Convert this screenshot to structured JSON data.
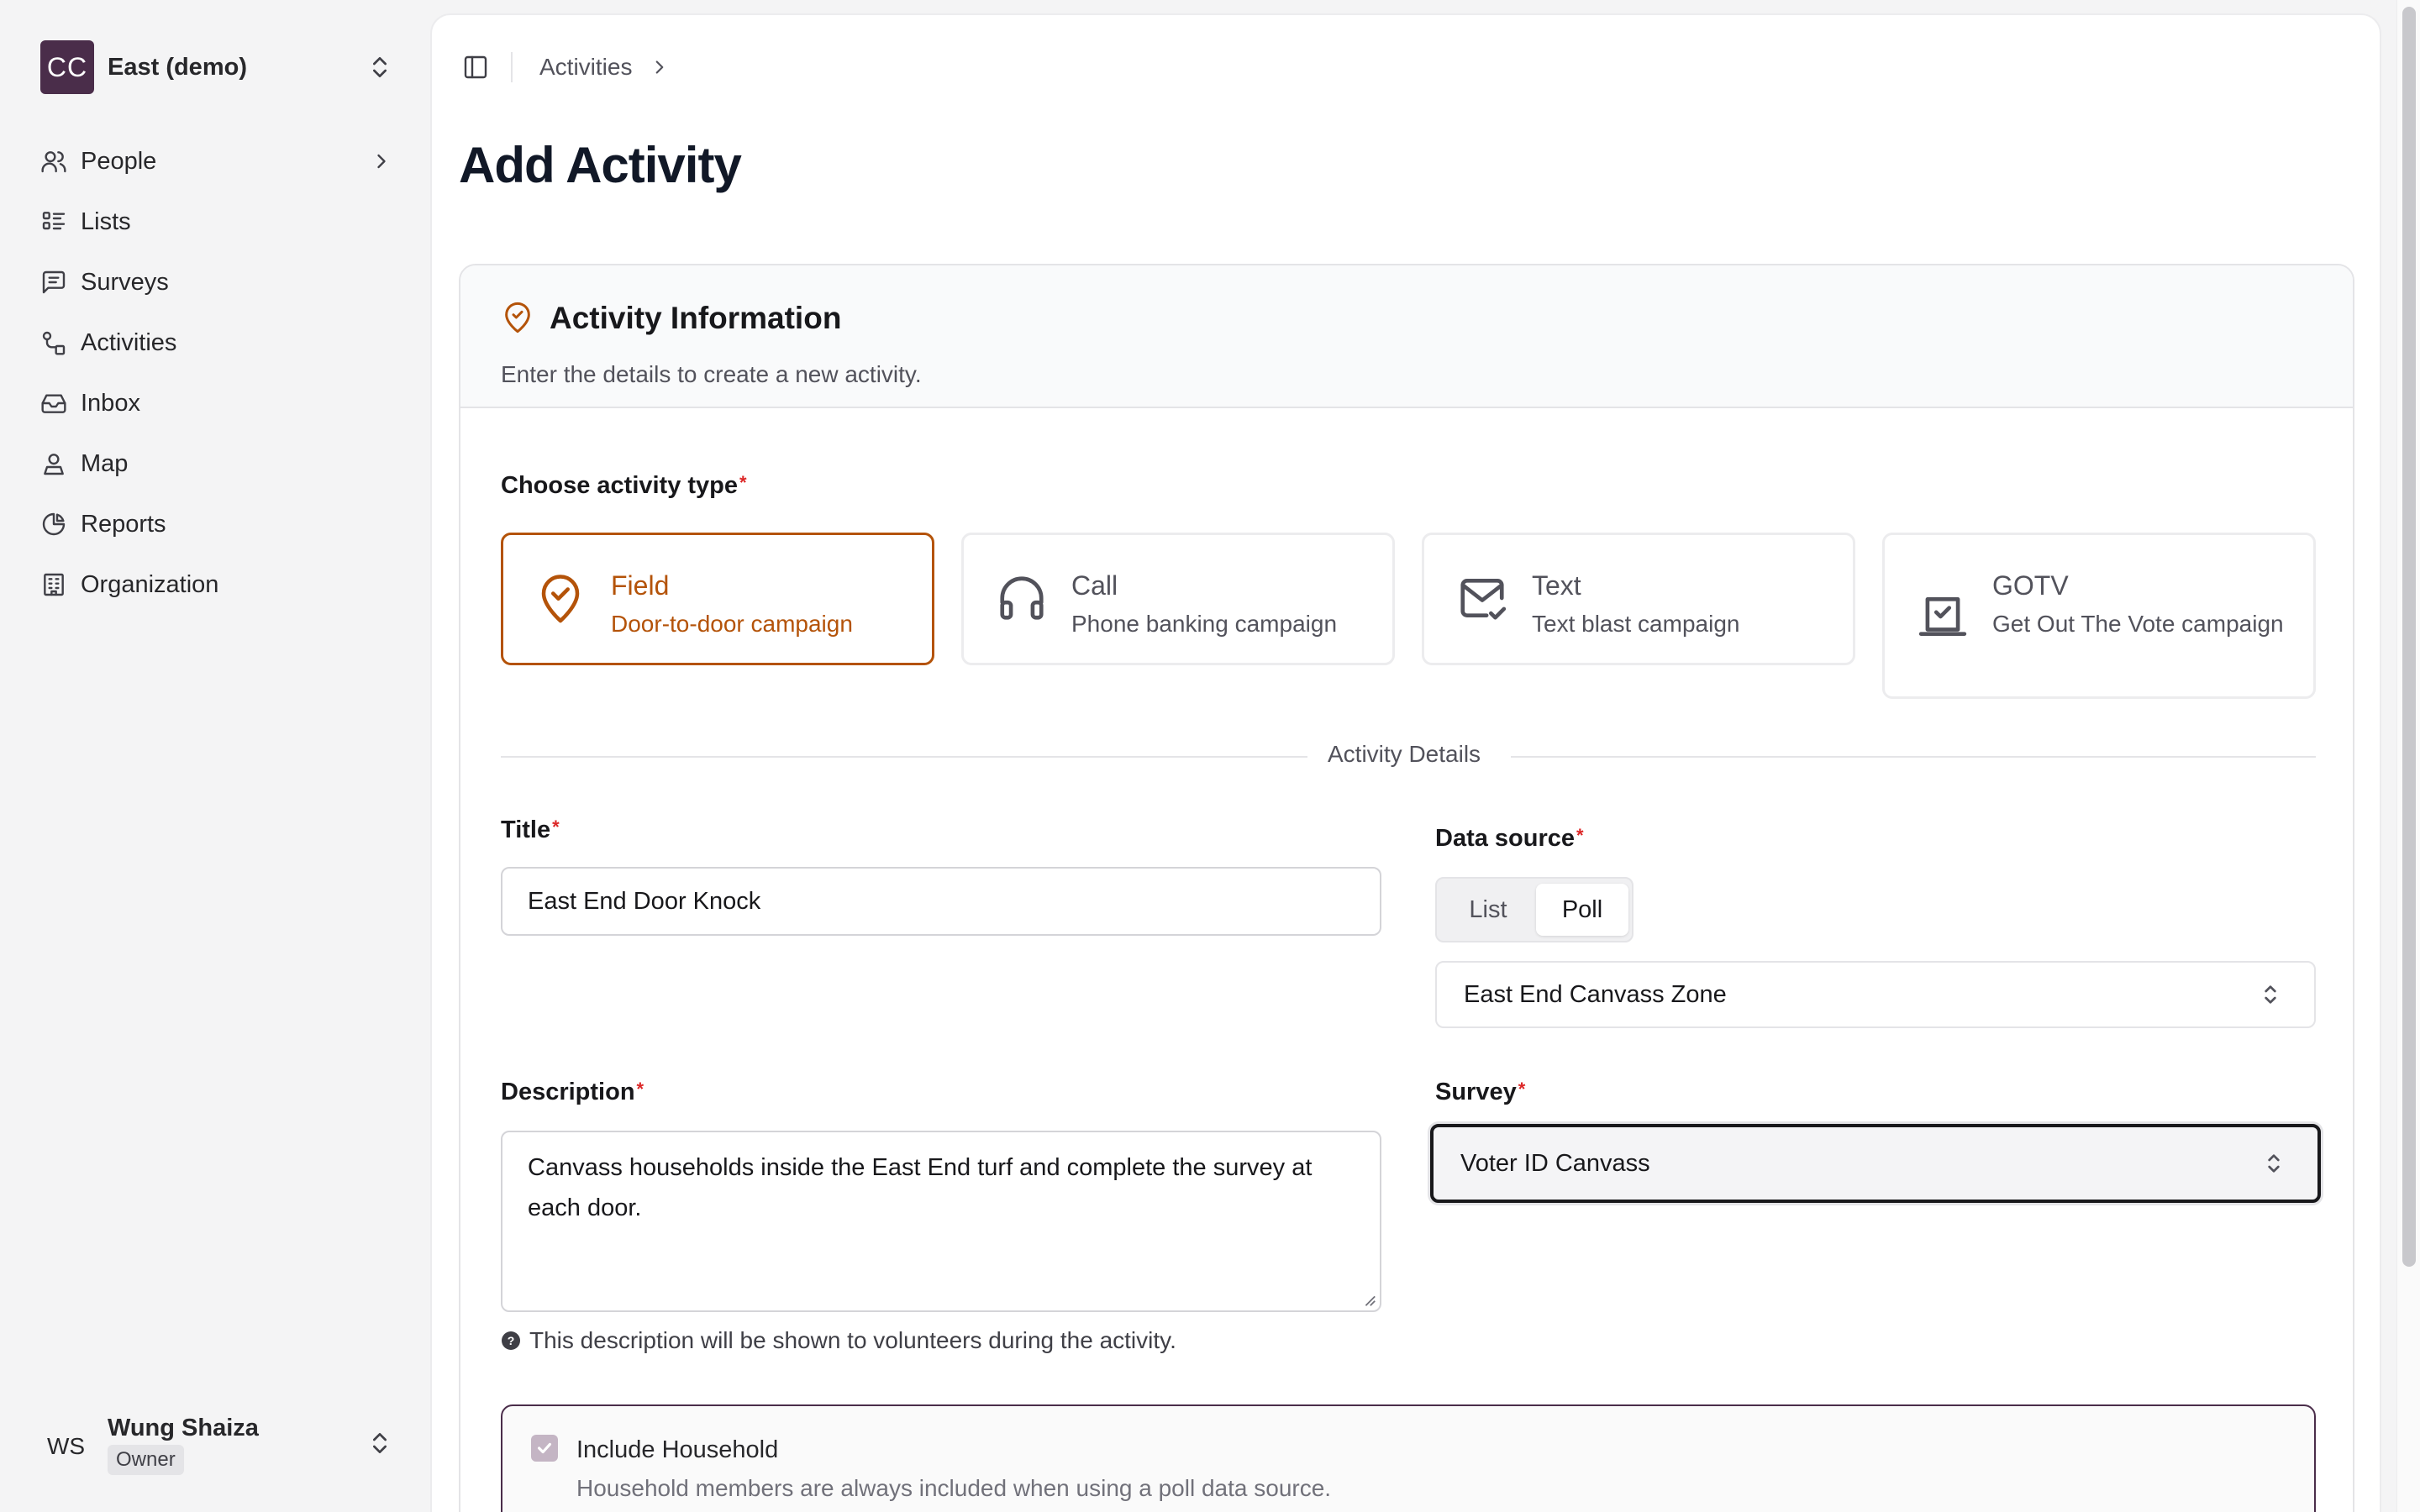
{
  "sidebar": {
    "org": {
      "initials": "CC",
      "name": "East (demo)"
    },
    "items": [
      {
        "label": "People",
        "icon": "users-icon"
      },
      {
        "label": "Lists",
        "icon": "list-icon"
      },
      {
        "label": "Surveys",
        "icon": "message-square-icon"
      },
      {
        "label": "Activities",
        "icon": "route-icon"
      },
      {
        "label": "Inbox",
        "icon": "inbox-icon"
      },
      {
        "label": "Map",
        "icon": "map-pin-user-icon"
      },
      {
        "label": "Reports",
        "icon": "pie-chart-icon"
      },
      {
        "label": "Organization",
        "icon": "building-icon"
      }
    ],
    "user": {
      "initials": "WS",
      "name": "Wung Shaiza",
      "role": "Owner"
    }
  },
  "topbar": {
    "breadcrumb": "Activities"
  },
  "page": {
    "title": "Add Activity"
  },
  "card": {
    "title": "Activity Information",
    "subtitle": "Enter the details to create a new activity."
  },
  "form": {
    "activity_type_label": "Choose activity type",
    "required_mark": "*",
    "types": [
      {
        "title": "Field",
        "desc": "Door-to-door campaign",
        "selected": true
      },
      {
        "title": "Call",
        "desc": "Phone banking campaign"
      },
      {
        "title": "Text",
        "desc": "Text blast campaign"
      },
      {
        "title": "GOTV",
        "desc": "Get Out The Vote campaign"
      }
    ],
    "section_label": "Activity Details",
    "title_label": "Title",
    "title_value": "East End Door Knock",
    "data_source_label": "Data source",
    "data_source_options": [
      "List",
      "Poll"
    ],
    "data_source_selected": "Poll",
    "data_source_value": "East End Canvass Zone",
    "description_label": "Description",
    "description_value": "Canvass households inside the East End turf and complete the survey at each door.",
    "description_hint": "This description will be shown to volunteers during the activity.",
    "survey_label": "Survey",
    "survey_value": "Voter ID Canvass",
    "include_household_label": "Include Household",
    "include_household_desc": "Household members are always included when using a poll data source."
  },
  "colors": {
    "accent": "#b45309",
    "brand": "#4a2d4a",
    "required": "#dc2626"
  }
}
